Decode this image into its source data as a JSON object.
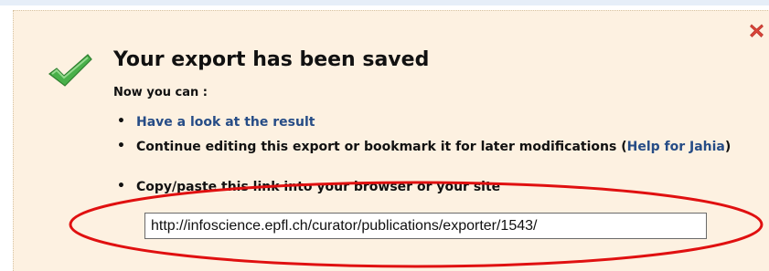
{
  "dialog": {
    "title": "Your export has been saved",
    "subtitle": "Now you can :",
    "items": [
      {
        "link": "Have a look at the result"
      },
      {
        "prefix": "Continue editing this export or bookmark it for later modifications (",
        "link": "Help for Jahia",
        "suffix": ")"
      },
      {
        "text": "Copy/paste this link into your browser or your site"
      }
    ],
    "url_value": "http://infoscience.epfl.ch/curator/publications/exporter/1543/"
  },
  "colors": {
    "panel_bg": "#fdf1e1",
    "link": "#264c86",
    "annotation": "#e01010",
    "check": "#3fa63f",
    "close": "#d9453a"
  },
  "icons": {
    "success": "checkmark-icon",
    "close": "close-x-icon"
  }
}
